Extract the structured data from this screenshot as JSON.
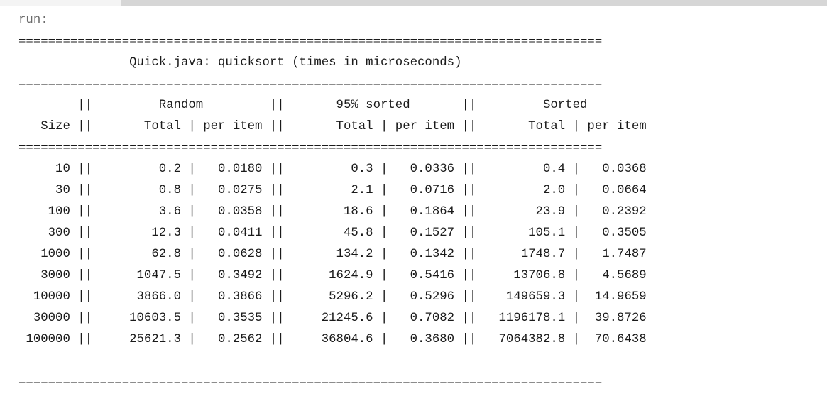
{
  "console": {
    "run_label": "run:",
    "separator": "===============================================================================",
    "title": "               Quick.java: quicksort (times in microseconds)",
    "header1": "        ||         Random         ||       95% sorted       ||         Sorted",
    "header2": "   Size ||       Total | per item ||       Total | per item ||       Total | per item",
    "rows": [
      "     10 ||         0.2 |   0.0180 ||         0.3 |   0.0336 ||         0.4 |   0.0368",
      "     30 ||         0.8 |   0.0275 ||         2.1 |   0.0716 ||         2.0 |   0.0664",
      "    100 ||         3.6 |   0.0358 ||        18.6 |   0.1864 ||        23.9 |   0.2392",
      "    300 ||        12.3 |   0.0411 ||        45.8 |   0.1527 ||       105.1 |   0.3505",
      "   1000 ||        62.8 |   0.0628 ||       134.2 |   0.1342 ||      1748.7 |   1.7487",
      "   3000 ||      1047.5 |   0.3492 ||      1624.9 |   0.5416 ||     13706.8 |   4.5689",
      "  10000 ||      3866.0 |   0.3866 ||      5296.2 |   0.5296 ||    149659.3 |  14.9659",
      "  30000 ||     10603.5 |   0.3535 ||     21245.6 |   0.7082 ||   1196178.1 |  39.8726",
      " 100000 ||     25621.3 |   0.2562 ||     36804.6 |   0.3680 ||   7064382.8 |  70.6438"
    ],
    "blank": " "
  }
}
